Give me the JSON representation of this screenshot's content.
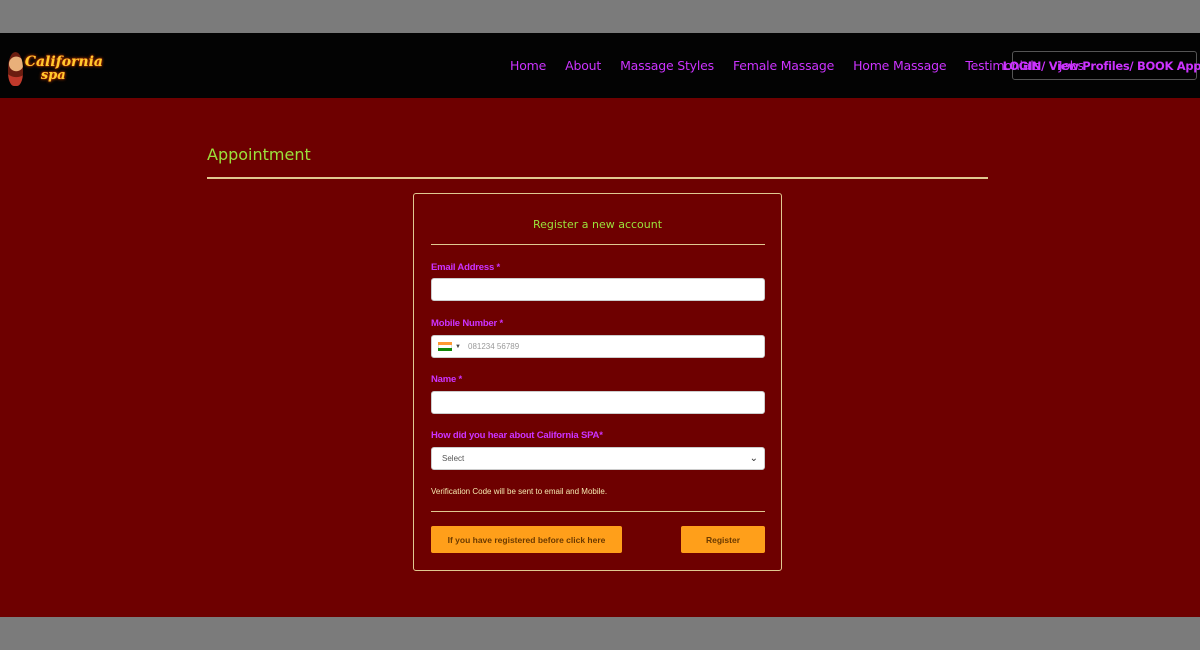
{
  "brand": {
    "line1": "California",
    "line2": "spa"
  },
  "nav": {
    "links": [
      "Home",
      "About",
      "Massage Styles",
      "Female Massage",
      "Home Massage",
      "Testimonials",
      "Jobs"
    ],
    "cta": "LOGIN/ View Profiles/ BOOK Appt"
  },
  "page": {
    "title": "Appointment"
  },
  "form": {
    "title": "Register a new account",
    "email_label": "Email Address *",
    "email_value": "",
    "mobile_label": "Mobile Number *",
    "mobile_placeholder": "081234 56789",
    "name_label": "Name *",
    "name_value": "",
    "source_label": "How did you hear about California SPA*",
    "source_selected": "Select",
    "note": "Verification Code will be sent to email and Mobile.",
    "login_button": "If you have registered before click here",
    "register_button": "Register"
  },
  "colors": {
    "nav_bg": "#030303",
    "main_bg": "#6e0000",
    "accent_purple": "#cc33ff",
    "accent_green": "#9be13b",
    "button_orange": "#ff9f1a"
  }
}
